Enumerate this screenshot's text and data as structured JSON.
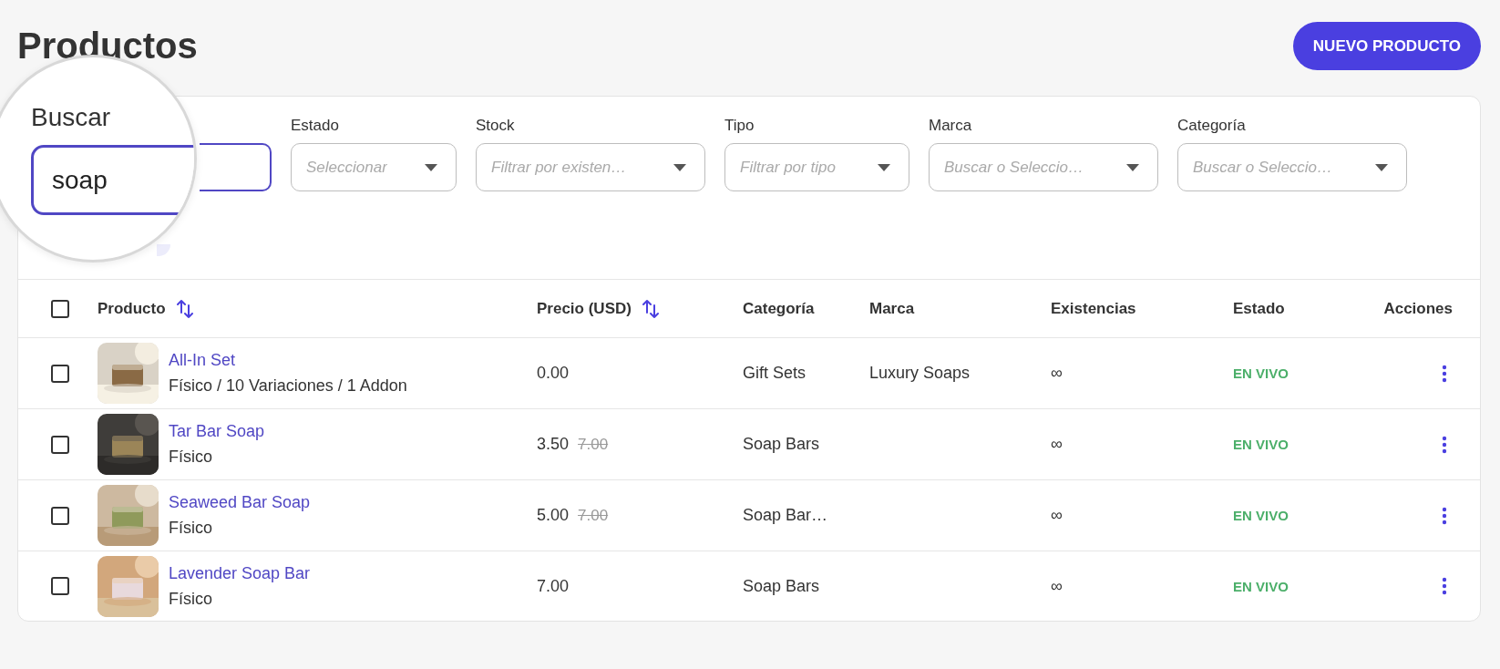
{
  "page": {
    "title": "Productos",
    "new_button": "NUEVO PRODUCTO"
  },
  "filters": {
    "search": {
      "label": "Buscar",
      "value": "soap"
    },
    "selects": [
      {
        "label": "Estado",
        "placeholder": "Seleccionar"
      },
      {
        "label": "Stock",
        "placeholder": "Filtrar por existen…"
      },
      {
        "label": "Tipo",
        "placeholder": "Filtrar por tipo"
      },
      {
        "label": "Marca",
        "placeholder": "Buscar o Seleccio…"
      },
      {
        "label": "Categoría",
        "placeholder": "Buscar o Seleccio…"
      }
    ]
  },
  "table": {
    "header_checkbox": {
      "checked": false
    },
    "columns": [
      {
        "label": "Producto",
        "sortable": true
      },
      {
        "label": "Precio (USD)",
        "sortable": true
      },
      {
        "label": "Categoría",
        "sortable": false
      },
      {
        "label": "Marca",
        "sortable": false
      },
      {
        "label": "Existencias",
        "sortable": false
      },
      {
        "label": "Estado",
        "sortable": false
      },
      {
        "label": "Acciones",
        "sortable": false
      }
    ],
    "rows": [
      {
        "checked": false,
        "name": "All-In Set",
        "subtitle": "Físico / 10 Variaciones / 1 Addon",
        "price": "0.00",
        "category": "Gift Sets",
        "brand": "Luxury Soaps",
        "stock": "∞",
        "status": "EN VIVO"
      },
      {
        "checked": false,
        "name": "Tar Bar Soap",
        "subtitle": "Físico",
        "price": "3.50",
        "old_price": "7.00",
        "category": "Soap Bars",
        "stock": "∞",
        "status": "EN VIVO"
      },
      {
        "checked": false,
        "name": "Seaweed Bar Soap",
        "subtitle": "Físico",
        "price": "5.00",
        "old_price": "7.00",
        "category": "Soap Bar…",
        "stock": "∞",
        "status": "EN VIVO"
      },
      {
        "checked": false,
        "name": "Lavender Soap Bar",
        "subtitle": "Físico",
        "price": "7.00",
        "category": "Soap Bars",
        "stock": "∞",
        "status": "EN VIVO"
      }
    ]
  }
}
